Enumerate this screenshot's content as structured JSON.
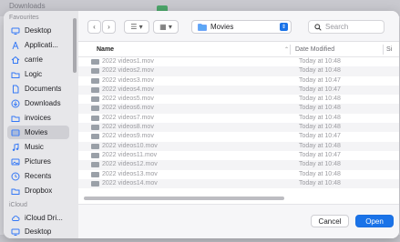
{
  "background": {
    "title": "Downloads"
  },
  "sidebar": {
    "favourites_heading": "Favourites",
    "items": [
      {
        "label": "Desktop",
        "icon": "desktop-icon",
        "selected": false
      },
      {
        "label": "Applicati...",
        "icon": "applications-icon",
        "selected": false
      },
      {
        "label": "carrie",
        "icon": "home-icon",
        "selected": false
      },
      {
        "label": "Logic",
        "icon": "folder-icon",
        "selected": false
      },
      {
        "label": "Documents",
        "icon": "document-icon",
        "selected": false
      },
      {
        "label": "Downloads",
        "icon": "downloads-icon",
        "selected": false
      },
      {
        "label": "invoices",
        "icon": "folder-icon",
        "selected": false
      },
      {
        "label": "Movies",
        "icon": "movies-icon",
        "selected": true
      },
      {
        "label": "Music",
        "icon": "music-icon",
        "selected": false
      },
      {
        "label": "Pictures",
        "icon": "pictures-icon",
        "selected": false
      },
      {
        "label": "Recents",
        "icon": "clock-icon",
        "selected": false
      },
      {
        "label": "Dropbox",
        "icon": "folder-icon",
        "selected": false
      }
    ],
    "icloud_heading": "iCloud",
    "icloud_items": [
      {
        "label": "iCloud Dri...",
        "icon": "cloud-icon"
      },
      {
        "label": "Desktop",
        "icon": "desktop-icon"
      }
    ]
  },
  "toolbar": {
    "back": "‹",
    "forward": "›",
    "list_view": "☰ ▾",
    "grid_view": "▦ ▾",
    "location": "Movies",
    "search_placeholder": "Search"
  },
  "table": {
    "headers": {
      "name": "Name",
      "date": "Date Modified",
      "size": "Si"
    },
    "rows": [
      {
        "name": "2022 videos1.mov",
        "date": "Today at 10:48"
      },
      {
        "name": "2022 videos2.mov",
        "date": "Today at 10:48"
      },
      {
        "name": "2022 videos3.mov",
        "date": "Today at 10:47"
      },
      {
        "name": "2022 videos4.mov",
        "date": "Today at 10:47"
      },
      {
        "name": "2022 videos5.mov",
        "date": "Today at 10:48"
      },
      {
        "name": "2022 videos6.mov",
        "date": "Today at 10:48"
      },
      {
        "name": "2022 videos7.mov",
        "date": "Today at 10:48"
      },
      {
        "name": "2022 videos8.mov",
        "date": "Today at 10:48"
      },
      {
        "name": "2022 videos9.mov",
        "date": "Today at 10:47"
      },
      {
        "name": "2022 videos10.mov",
        "date": "Today at 10:48"
      },
      {
        "name": "2022 videos11.mov",
        "date": "Today at 10:47"
      },
      {
        "name": "2022 videos12.mov",
        "date": "Today at 10:48"
      },
      {
        "name": "2022 videos13.mov",
        "date": "Today at 10:48"
      },
      {
        "name": "2022 videos14.mov",
        "date": "Today at 10:48"
      }
    ]
  },
  "footer": {
    "cancel": "Cancel",
    "open": "Open"
  },
  "colors": {
    "accent": "#1a73e8",
    "sidebar_bg": "#e7e7ea",
    "selected_bg": "#cfcfd4"
  }
}
